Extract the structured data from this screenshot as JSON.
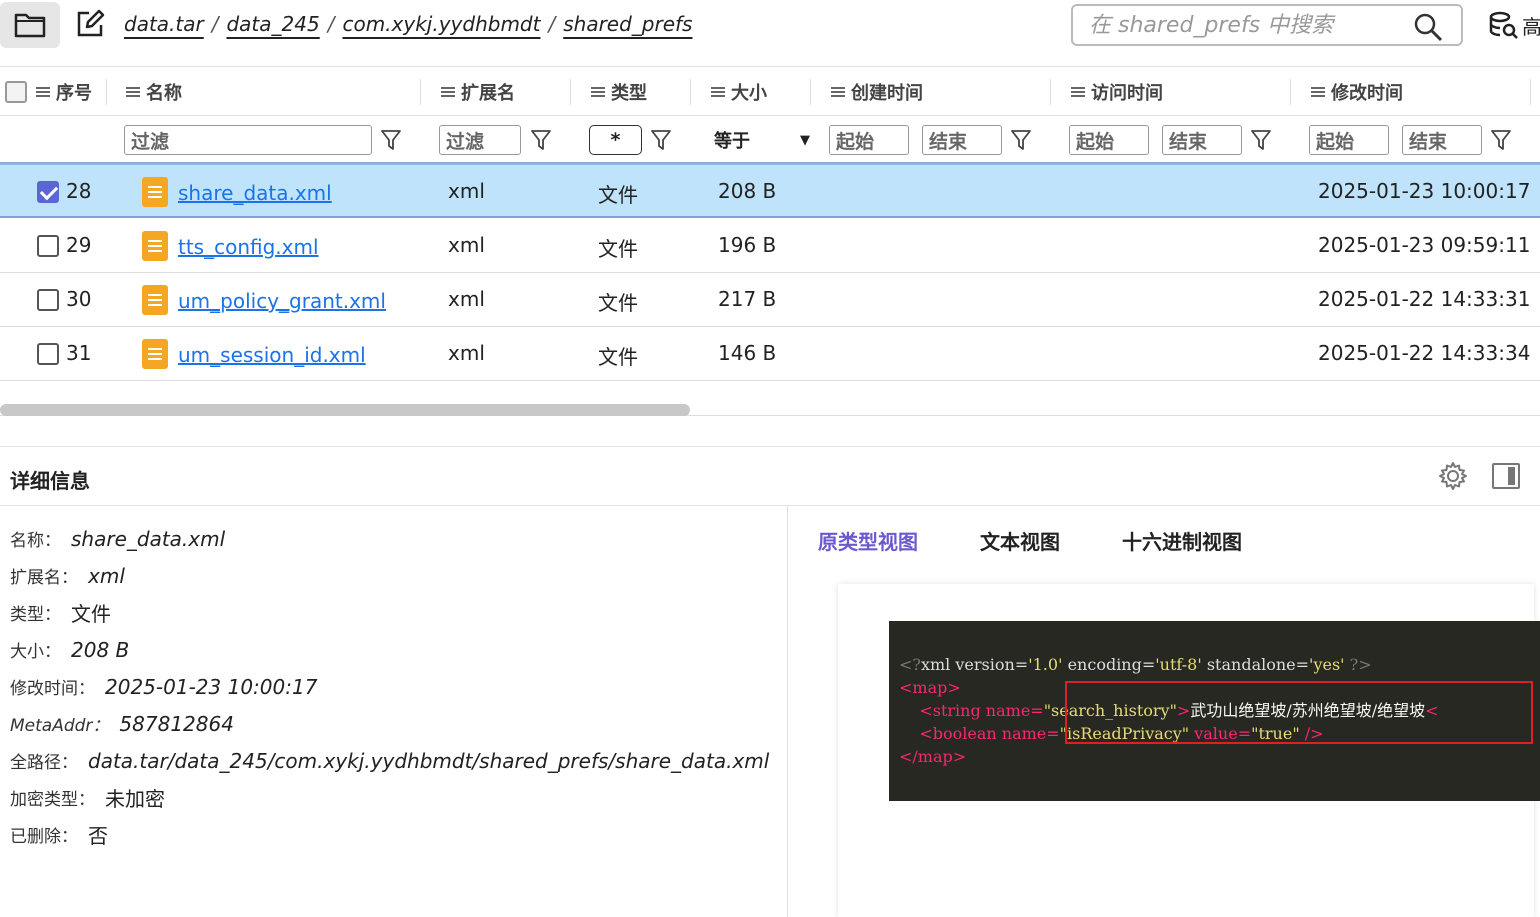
{
  "breadcrumb": [
    "data.tar",
    "data_245",
    "com.xykj.yydhbmdt",
    "shared_prefs"
  ],
  "search": {
    "placeholder": "在 shared_prefs 中搜索"
  },
  "adv_search_label": "高",
  "columns": {
    "index": "序号",
    "name": "名称",
    "ext": "扩展名",
    "type": "类型",
    "size": "大小",
    "created": "创建时间",
    "accessed": "访问时间",
    "modified": "修改时间"
  },
  "filters": {
    "name": "过滤",
    "ext": "过滤",
    "type": "*",
    "size_op": "等于",
    "start": "起始",
    "end": "结束"
  },
  "rows": [
    {
      "index": "28",
      "name": "share_data.xml",
      "ext": "xml",
      "type": "文件",
      "size": "208 B",
      "modified": "2025-01-23 10:00:17",
      "checked": true
    },
    {
      "index": "29",
      "name": "tts_config.xml",
      "ext": "xml",
      "type": "文件",
      "size": "196 B",
      "modified": "2025-01-23 09:59:11",
      "checked": false
    },
    {
      "index": "30",
      "name": "um_policy_grant.xml",
      "ext": "xml",
      "type": "文件",
      "size": "217 B",
      "modified": "2025-01-22 14:33:31",
      "checked": false
    },
    {
      "index": "31",
      "name": "um_session_id.xml",
      "ext": "xml",
      "type": "文件",
      "size": "146 B",
      "modified": "2025-01-22 14:33:34",
      "checked": false
    }
  ],
  "detail": {
    "title": "详细信息",
    "props": [
      {
        "label": "名称：",
        "value": "share_data.xml"
      },
      {
        "label": "扩展名：",
        "value": "xml"
      },
      {
        "label": "类型：",
        "value": "文件"
      },
      {
        "label": "大小：",
        "value": "208 B"
      },
      {
        "label": "修改时间：",
        "value": "2025-01-23 10:00:17"
      },
      {
        "label": "MetaAddr：",
        "value": "587812864"
      },
      {
        "label": "全路径：",
        "value": "data.tar/data_245/com.xykj.yydhbmdt/shared_prefs/share_data.xml"
      },
      {
        "label": "加密类型：",
        "value": "未加密"
      },
      {
        "label": "已删除：",
        "value": "否"
      }
    ],
    "tabs": [
      "原类型视图",
      "文本视图",
      "十六进制视图"
    ],
    "active_tab": 0
  },
  "xml_preview": {
    "decl_version": "1.0",
    "decl_encoding": "utf-8",
    "decl_standalone": "yes",
    "string_name": "search_history",
    "string_value": "武功山绝望坡/苏州绝望坡/绝望坡",
    "boolean_name": "isReadPrivacy",
    "boolean_value": "true"
  },
  "colors": {
    "accent": "#6a5acd",
    "selected_row": "#bfe3fb",
    "link": "#1a73e8",
    "file_icon": "#f5a623",
    "highlight_box": "#e02020"
  }
}
